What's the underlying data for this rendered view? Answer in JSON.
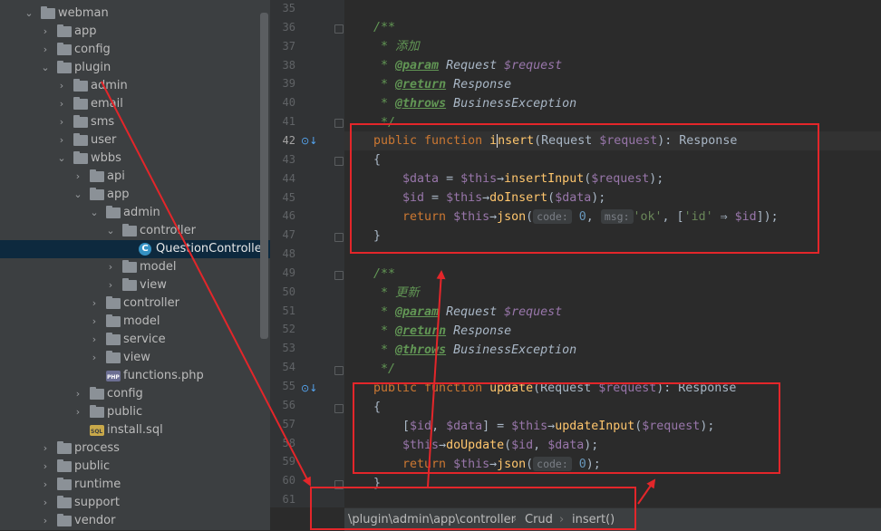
{
  "project_tree": {
    "items": [
      {
        "label": "webman",
        "type": "folder",
        "depth": 0,
        "expanded": true
      },
      {
        "label": "app",
        "type": "folder",
        "depth": 1,
        "expanded": false
      },
      {
        "label": "config",
        "type": "folder",
        "depth": 1,
        "expanded": false
      },
      {
        "label": "plugin",
        "type": "folder",
        "depth": 1,
        "expanded": true
      },
      {
        "label": "admin",
        "type": "folder",
        "depth": 2,
        "expanded": false
      },
      {
        "label": "email",
        "type": "folder",
        "depth": 2,
        "expanded": false
      },
      {
        "label": "sms",
        "type": "folder",
        "depth": 2,
        "expanded": false
      },
      {
        "label": "user",
        "type": "folder",
        "depth": 2,
        "expanded": false
      },
      {
        "label": "wbbs",
        "type": "folder",
        "depth": 2,
        "expanded": true
      },
      {
        "label": "api",
        "type": "folder",
        "depth": 3,
        "expanded": false
      },
      {
        "label": "app",
        "type": "folder",
        "depth": 3,
        "expanded": true
      },
      {
        "label": "admin",
        "type": "folder",
        "depth": 4,
        "expanded": true
      },
      {
        "label": "controller",
        "type": "folder",
        "depth": 5,
        "expanded": true
      },
      {
        "label": "QuestionController.php",
        "type": "class",
        "depth": 6,
        "selected": true
      },
      {
        "label": "model",
        "type": "folder",
        "depth": 5,
        "expanded": false
      },
      {
        "label": "view",
        "type": "folder",
        "depth": 5,
        "expanded": false
      },
      {
        "label": "controller",
        "type": "folder",
        "depth": 4,
        "expanded": false
      },
      {
        "label": "model",
        "type": "folder",
        "depth": 4,
        "expanded": false
      },
      {
        "label": "service",
        "type": "folder",
        "depth": 4,
        "expanded": false
      },
      {
        "label": "view",
        "type": "folder",
        "depth": 4,
        "expanded": false
      },
      {
        "label": "functions.php",
        "type": "php",
        "depth": 4
      },
      {
        "label": "config",
        "type": "folder",
        "depth": 3,
        "expanded": false
      },
      {
        "label": "public",
        "type": "folder",
        "depth": 3,
        "expanded": false
      },
      {
        "label": "install.sql",
        "type": "sql",
        "depth": 3
      },
      {
        "label": "process",
        "type": "folder",
        "depth": 1,
        "expanded": false
      },
      {
        "label": "public",
        "type": "folder",
        "depth": 1,
        "expanded": false
      },
      {
        "label": "runtime",
        "type": "folder",
        "depth": 1,
        "expanded": false
      },
      {
        "label": "support",
        "type": "folder",
        "depth": 1,
        "expanded": false
      },
      {
        "label": "vendor",
        "type": "folder",
        "depth": 1,
        "expanded": false
      }
    ]
  },
  "editor": {
    "line_numbers": [
      "35",
      "36",
      "37",
      "38",
      "39",
      "40",
      "41",
      "42",
      "43",
      "44",
      "45",
      "46",
      "47",
      "48",
      "49",
      "50",
      "51",
      "52",
      "53",
      "54",
      "55",
      "56",
      "57",
      "58",
      "59",
      "60",
      "61"
    ],
    "current_line": "42",
    "code": {
      "l36": "/**",
      "l37_star": " * ",
      "l37_text": "添加",
      "l38_star": " * ",
      "l38_tag": "@param",
      "l38_type": " Request ",
      "l38_var": "$request",
      "l39_star": " * ",
      "l39_tag": "@return",
      "l39_type": " Response",
      "l40_star": " * ",
      "l40_tag": "@throws",
      "l40_type": " BusinessException",
      "l41": " */",
      "l42_kw1": "public ",
      "l42_kw2": "function ",
      "l42_fn_a": "i",
      "l42_fn_b": "nsert",
      "l42_p1": "(Request ",
      "l42_var": "$request",
      "l42_p2": "): Response",
      "l43": "{",
      "l44_var1": "    $data",
      "l44_p1": " = ",
      "l44_var2": "$this",
      "l44_p2": "→",
      "l44_fn": "insertInput",
      "l44_p3": "(",
      "l44_var3": "$request",
      "l44_p4": ");",
      "l45_var1": "    $id",
      "l45_p1": " = ",
      "l45_var2": "$this",
      "l45_p2": "→",
      "l45_fn": "doInsert",
      "l45_p3": "(",
      "l45_var3": "$data",
      "l45_p4": ");",
      "l46_kw": "    return ",
      "l46_var1": "$this",
      "l46_p1": "→",
      "l46_fn": "json",
      "l46_p2": "(",
      "l46_hint1": "code:",
      "l46_num": " 0",
      "l46_p3": ", ",
      "l46_hint2": "msg:",
      "l46_str1": "'ok'",
      "l46_p4": ", [",
      "l46_str2": "'id'",
      "l46_p5": " ⇒ ",
      "l46_var2": "$id",
      "l46_p6": "]);",
      "l47": "}",
      "l49": "/**",
      "l50_star": " * ",
      "l50_text": "更新",
      "l51_star": " * ",
      "l51_tag": "@param",
      "l51_type": " Request ",
      "l51_var": "$request",
      "l52_star": " * ",
      "l52_tag": "@return",
      "l52_type": " Response",
      "l53_star": " * ",
      "l53_tag": "@throws",
      "l53_type": " BusinessException",
      "l54": " */",
      "l55_kw1": "public ",
      "l55_kw2": "function ",
      "l55_fn": "update",
      "l55_p1": "(Request ",
      "l55_var": "$request",
      "l55_p2": "): Response",
      "l56": "{",
      "l57_p0": "    [",
      "l57_var1": "$id",
      "l57_p1": ", ",
      "l57_var2": "$data",
      "l57_p2": "] = ",
      "l57_var3": "$this",
      "l57_p3": "→",
      "l57_fn": "updateInput",
      "l57_p4": "(",
      "l57_var4": "$request",
      "l57_p5": ");",
      "l58_var1": "    $this",
      "l58_p1": "→",
      "l58_fn": "doUpdate",
      "l58_p2": "(",
      "l58_var2": "$id",
      "l58_p3": ", ",
      "l58_var3": "$data",
      "l58_p4": ");",
      "l59_kw": "    return ",
      "l59_var1": "$this",
      "l59_p1": "→",
      "l59_fn": "json",
      "l59_p2": "(",
      "l59_hint": "code:",
      "l59_num": " 0",
      "l59_p3": ");",
      "l60": "}"
    }
  },
  "breadcrumb": {
    "path": "\\plugin\\admin\\app\\controller",
    "class": "Crud",
    "method": "insert()",
    "sep1": "›",
    "sep2": "›"
  },
  "colors": {
    "annotation": "#e3262a"
  }
}
